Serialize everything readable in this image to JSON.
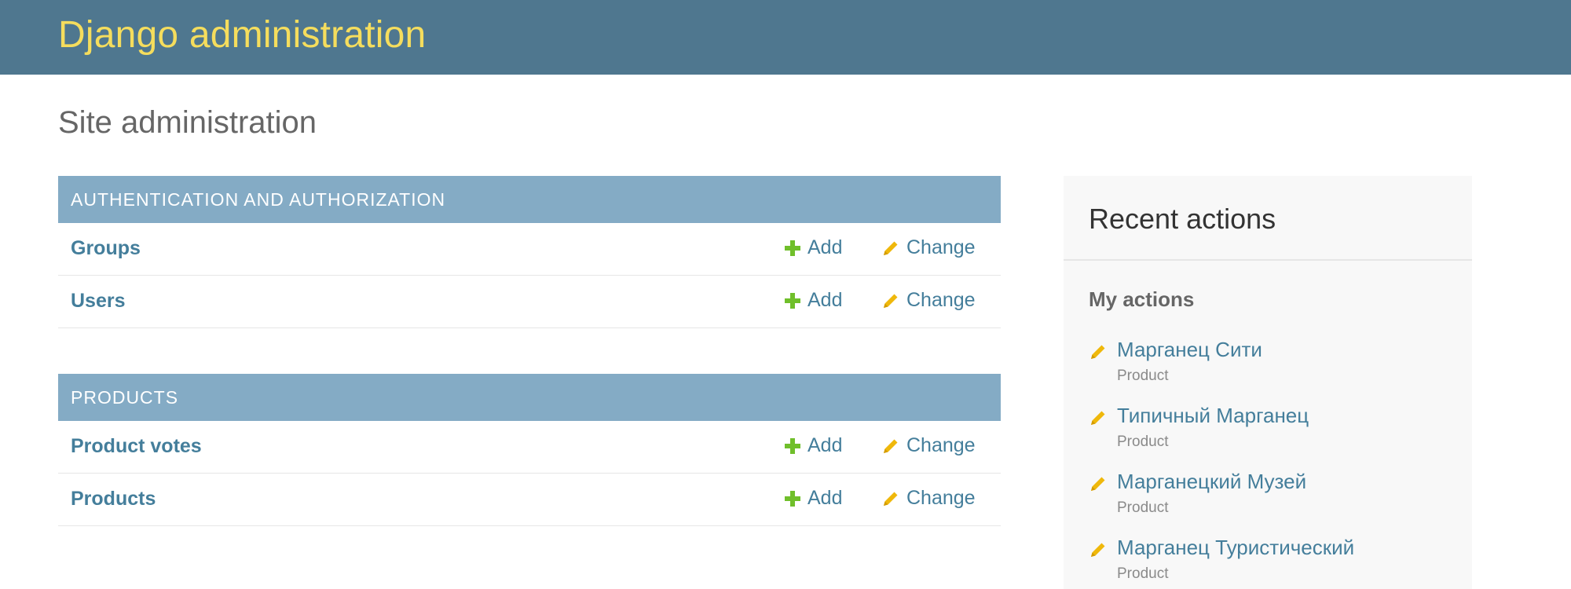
{
  "header": {
    "brand": "Django administration"
  },
  "page": {
    "title": "Site administration"
  },
  "modules": [
    {
      "caption": "AUTHENTICATION AND AUTHORIZATION",
      "models": [
        {
          "name": "Groups",
          "add": "Add",
          "change": "Change"
        },
        {
          "name": "Users",
          "add": "Add",
          "change": "Change"
        }
      ]
    },
    {
      "caption": "PRODUCTS",
      "models": [
        {
          "name": "Product votes",
          "add": "Add",
          "change": "Change"
        },
        {
          "name": "Products",
          "add": "Add",
          "change": "Change"
        }
      ]
    }
  ],
  "sidebar": {
    "title": "Recent actions",
    "subtitle": "My actions",
    "items": [
      {
        "label": "Марганец Сити",
        "type": "Product",
        "icon": "pencil-icon"
      },
      {
        "label": "Типичный Марганец",
        "type": "Product",
        "icon": "pencil-icon"
      },
      {
        "label": "Марганецкий Музей",
        "type": "Product",
        "icon": "pencil-icon"
      },
      {
        "label": "Марганец Туристический",
        "type": "Product",
        "icon": "pencil-icon"
      }
    ]
  },
  "icons": {
    "add": "plus-icon",
    "change": "pencil-icon"
  },
  "colors": {
    "header_bg": "#4f778f",
    "brand": "#f5dd5d",
    "module_caption_bg": "#84abc5",
    "link": "#447e9b",
    "add_icon": "#70bf2b",
    "change_icon": "#efb80b",
    "sidebar_bg": "#f8f8f8"
  }
}
